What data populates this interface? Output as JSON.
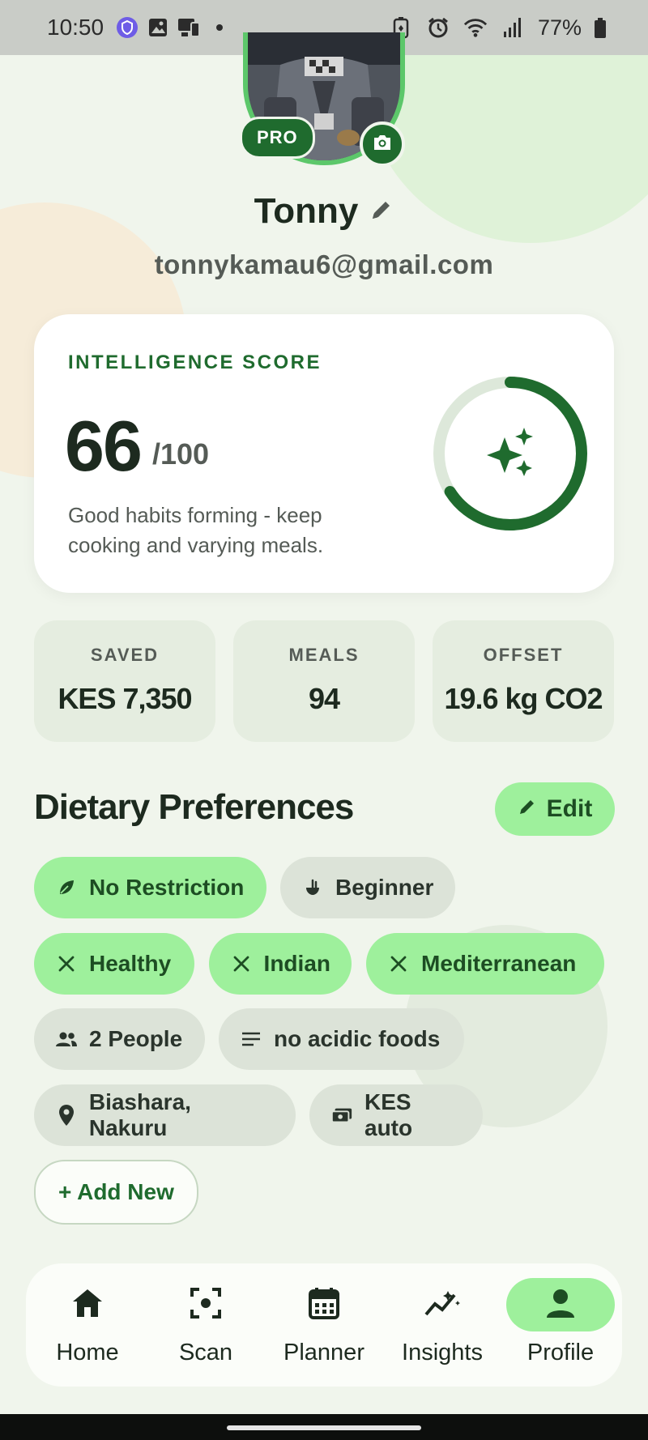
{
  "status_bar": {
    "time": "10:50",
    "battery": "77%",
    "icons": [
      "shield-icon",
      "gallery-icon",
      "cast-icon",
      "dot-icon",
      "battery-saver-icon",
      "alarm-icon",
      "wifi-icon",
      "signal-icon",
      "battery-icon"
    ]
  },
  "profile": {
    "badge": "PRO",
    "name": "Tonny",
    "email": "tonnykamau6@gmail.com"
  },
  "score_card": {
    "label": "INTELLIGENCE SCORE",
    "value": "66",
    "max": "/100",
    "description": "Good habits forming - keep cooking and varying meals.",
    "progress": 0.66
  },
  "stats": [
    {
      "label": "SAVED",
      "value": "KES 7,350"
    },
    {
      "label": "MEALS",
      "value": "94"
    },
    {
      "label": "OFFSET",
      "value": "19.6 kg CO2"
    }
  ],
  "dietary": {
    "title": "Dietary Preferences",
    "edit_label": "Edit",
    "chips": [
      {
        "label": "No Restriction",
        "icon": "leaf-icon"
      },
      {
        "label": "Beginner",
        "icon": "ladle-icon"
      },
      {
        "label": "Healthy",
        "icon": "utensils-icon"
      },
      {
        "label": "Indian",
        "icon": "utensils-icon"
      },
      {
        "label": "Mediterranean",
        "icon": "utensils-icon"
      },
      {
        "label": "2 People",
        "icon": "people-icon"
      },
      {
        "label": "no acidic foods",
        "icon": "notes-icon"
      },
      {
        "label": "Biashara, Nakuru",
        "icon": "location-icon"
      },
      {
        "label": "KES auto",
        "icon": "currency-icon"
      }
    ],
    "add_label": "+ Add New"
  },
  "nav": {
    "items": [
      {
        "label": "Home",
        "icon": "home-icon"
      },
      {
        "label": "Scan",
        "icon": "scan-icon"
      },
      {
        "label": "Planner",
        "icon": "calendar-icon"
      },
      {
        "label": "Insights",
        "icon": "insights-icon"
      },
      {
        "label": "Profile",
        "icon": "person-icon"
      }
    ],
    "active": "Profile"
  },
  "colors": {
    "primary": "#1f6b2e",
    "accent": "#9ef09c",
    "background": "#f0f5ec"
  }
}
